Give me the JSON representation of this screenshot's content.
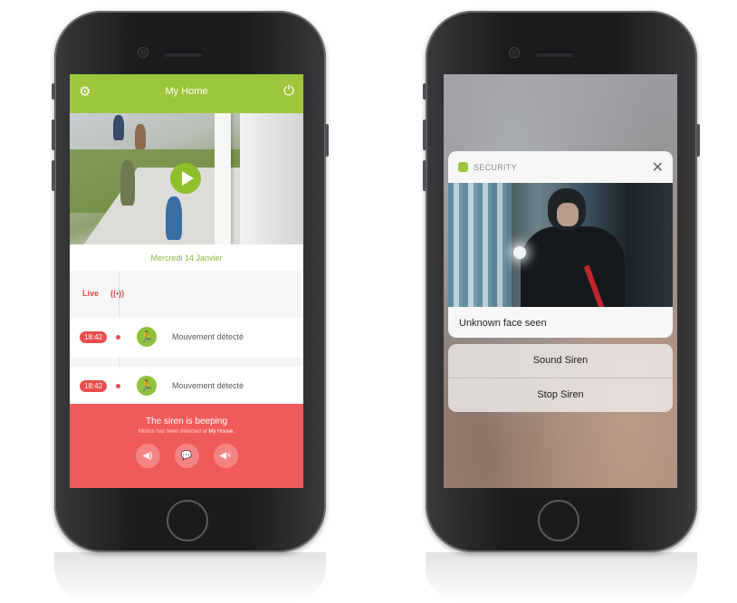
{
  "left_phone": {
    "app": {
      "title": "My Home",
      "settings_icon": "gear-icon",
      "power_icon": "power-icon"
    },
    "video": {
      "play_icon": "play-icon"
    },
    "date": "Mercredi 14 Janvier",
    "live": {
      "label": "Live",
      "signal": "((•))"
    },
    "events": [
      {
        "time": "18:42",
        "label": "Mouvement détecté",
        "icon": "motion-icon"
      },
      {
        "time": "18:42",
        "label": "Mouvement détecté",
        "icon": "motion-icon"
      }
    ],
    "alert": {
      "title": "The siren is beeping",
      "sub_prefix": "Motion has been detected at ",
      "sub_place": "My House.",
      "buttons": [
        {
          "icon": "speaker-icon",
          "glyph": "◀)"
        },
        {
          "icon": "chat-icon",
          "glyph": "💬"
        },
        {
          "icon": "mute-icon",
          "glyph": "◀×"
        }
      ]
    }
  },
  "right_phone": {
    "notification": {
      "app_name": "SECURITY",
      "close": "✕",
      "message": "Unknown face seen"
    },
    "actions": [
      {
        "label": "Sound Siren"
      },
      {
        "label": "Stop Siren"
      }
    ]
  },
  "colors": {
    "brand_green": "#9dc63a",
    "alert_red": "#f15a5a",
    "time_badge": "#e94c4c"
  }
}
